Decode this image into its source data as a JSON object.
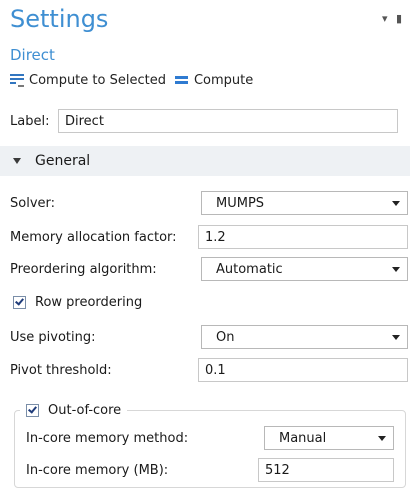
{
  "header": {
    "title": "Settings",
    "subtitle": "Direct",
    "dropdown_glyph": "▾",
    "pin_glyph": "▮"
  },
  "toolbar": {
    "compute_selected_label": "Compute to Selected",
    "compute_label": "Compute"
  },
  "label_field": {
    "label": "Label:",
    "value": "Direct"
  },
  "section": {
    "title": "General",
    "expanded": true
  },
  "fields": {
    "solver": {
      "label": "Solver:",
      "value": "MUMPS"
    },
    "memory_factor": {
      "label": "Memory allocation factor:",
      "value": "1.2"
    },
    "preordering": {
      "label": "Preordering algorithm:",
      "value": "Automatic"
    },
    "row_preordering": {
      "label": "Row preordering",
      "checked": true
    },
    "pivoting": {
      "label": "Use pivoting:",
      "value": "On"
    },
    "pivot_threshold": {
      "label": "Pivot threshold:",
      "value": "0.1"
    }
  },
  "out_of_core": {
    "label": "Out-of-core",
    "checked": true,
    "memory_method": {
      "label": "In-core memory method:",
      "value": "Manual"
    },
    "memory_mb": {
      "label": "In-core memory (MB):",
      "value": "512"
    }
  },
  "colors": {
    "accent": "#3f8fd2",
    "section_bg": "#eef1f4",
    "border": "#c8c8c8"
  },
  "icons": {
    "compute_selected": "compute-to-selected-icon",
    "compute": "compute-icon"
  }
}
